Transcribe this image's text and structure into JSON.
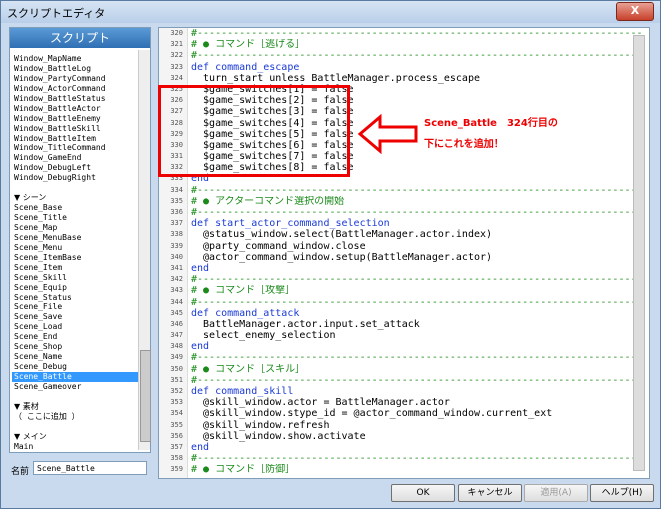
{
  "window": {
    "title": "スクリプトエディタ",
    "close_label": "X"
  },
  "left": {
    "header": "スクリプト",
    "items": [
      {
        "label": "Window_MapName",
        "type": "item"
      },
      {
        "label": "Window_BattleLog",
        "type": "item"
      },
      {
        "label": "Window_PartyCommand",
        "type": "item"
      },
      {
        "label": "Window_ActorCommand",
        "type": "item"
      },
      {
        "label": "Window_BattleStatus",
        "type": "item"
      },
      {
        "label": "Window_BattleActor",
        "type": "item"
      },
      {
        "label": "Window_BattleEnemy",
        "type": "item"
      },
      {
        "label": "Window_BattleSkill",
        "type": "item"
      },
      {
        "label": "Window_BattleItem",
        "type": "item"
      },
      {
        "label": "Window_TitleCommand",
        "type": "item"
      },
      {
        "label": "Window_GameEnd",
        "type": "item"
      },
      {
        "label": "Window_DebugLeft",
        "type": "item"
      },
      {
        "label": "Window_DebugRight",
        "type": "item"
      },
      {
        "label": "",
        "type": "blank"
      },
      {
        "label": "▼ シーン",
        "type": "section"
      },
      {
        "label": "Scene_Base",
        "type": "item"
      },
      {
        "label": "Scene_Title",
        "type": "item"
      },
      {
        "label": "Scene_Map",
        "type": "item"
      },
      {
        "label": "Scene_MenuBase",
        "type": "item"
      },
      {
        "label": "Scene_Menu",
        "type": "item"
      },
      {
        "label": "Scene_ItemBase",
        "type": "item"
      },
      {
        "label": "Scene_Item",
        "type": "item"
      },
      {
        "label": "Scene_Skill",
        "type": "item"
      },
      {
        "label": "Scene_Equip",
        "type": "item"
      },
      {
        "label": "Scene_Status",
        "type": "item"
      },
      {
        "label": "Scene_File",
        "type": "item"
      },
      {
        "label": "Scene_Save",
        "type": "item"
      },
      {
        "label": "Scene_Load",
        "type": "item"
      },
      {
        "label": "Scene_End",
        "type": "item"
      },
      {
        "label": "Scene_Shop",
        "type": "item"
      },
      {
        "label": "Scene_Name",
        "type": "item"
      },
      {
        "label": "Scene_Debug",
        "type": "item"
      },
      {
        "label": "Scene_Battle",
        "type": "item",
        "selected": true
      },
      {
        "label": "Scene_Gameover",
        "type": "item"
      },
      {
        "label": "",
        "type": "blank"
      },
      {
        "label": "▼ 素材",
        "type": "section"
      },
      {
        "label": "（ ここに追加 ）",
        "type": "item"
      },
      {
        "label": "",
        "type": "blank"
      },
      {
        "label": "▼ メイン",
        "type": "section"
      },
      {
        "label": "Main",
        "type": "item"
      }
    ],
    "name_label": "名前",
    "name_value": "Scene_Battle"
  },
  "editor": {
    "line_numbers": [
      "320",
      "321",
      "322",
      "323",
      "324",
      "325",
      "326",
      "327",
      "328",
      "329",
      "330",
      "331",
      "332",
      "333",
      "334",
      "335",
      "336",
      "337",
      "338",
      "339",
      "340",
      "341",
      "342",
      "343",
      "344",
      "345",
      "346",
      "347",
      "348",
      "349",
      "350",
      "351",
      "352",
      "353",
      "354",
      "355",
      "356",
      "357",
      "358",
      "359"
    ],
    "lines": [
      {
        "text": "#--------------------------------------------------------------------------",
        "cls": "cm"
      },
      {
        "text": "# ● コマンド［逃げる］",
        "cls": "cm"
      },
      {
        "text": "#--------------------------------------------------------------------------",
        "cls": "cm"
      },
      {
        "text": "def command_escape",
        "cls": "kw"
      },
      {
        "text": "  turn_start unless BattleManager.process_escape",
        "cls": ""
      },
      {
        "text": "  $game_switches[1] = false",
        "cls": ""
      },
      {
        "text": "  $game_switches[2] = false",
        "cls": ""
      },
      {
        "text": "  $game_switches[3] = false",
        "cls": ""
      },
      {
        "text": "  $game_switches[4] = false",
        "cls": ""
      },
      {
        "text": "  $game_switches[5] = false",
        "cls": ""
      },
      {
        "text": "  $game_switches[6] = false",
        "cls": ""
      },
      {
        "text": "  $game_switches[7] = false",
        "cls": ""
      },
      {
        "text": "  $game_switches[8] = false",
        "cls": ""
      },
      {
        "text": "end",
        "cls": "kw"
      },
      {
        "text": "#--------------------------------------------------------------------------",
        "cls": "cm"
      },
      {
        "text": "# ● アクターコマンド選択の開始",
        "cls": "cm"
      },
      {
        "text": "#--------------------------------------------------------------------------",
        "cls": "cm"
      },
      {
        "text": "def start_actor_command_selection",
        "cls": "kw"
      },
      {
        "text": "  @status_window.select(BattleManager.actor.index)",
        "cls": ""
      },
      {
        "text": "  @party_command_window.close",
        "cls": ""
      },
      {
        "text": "  @actor_command_window.setup(BattleManager.actor)",
        "cls": ""
      },
      {
        "text": "end",
        "cls": "kw"
      },
      {
        "text": "#--------------------------------------------------------------------------",
        "cls": "cm"
      },
      {
        "text": "# ● コマンド［攻撃］",
        "cls": "cm"
      },
      {
        "text": "#--------------------------------------------------------------------------",
        "cls": "cm"
      },
      {
        "text": "def command_attack",
        "cls": "kw"
      },
      {
        "text": "  BattleManager.actor.input.set_attack",
        "cls": ""
      },
      {
        "text": "  select_enemy_selection",
        "cls": ""
      },
      {
        "text": "end",
        "cls": "kw"
      },
      {
        "text": "#--------------------------------------------------------------------------",
        "cls": "cm"
      },
      {
        "text": "# ● コマンド［スキル］",
        "cls": "cm"
      },
      {
        "text": "#--------------------------------------------------------------------------",
        "cls": "cm"
      },
      {
        "text": "def command_skill",
        "cls": "kw"
      },
      {
        "text": "  @skill_window.actor = BattleManager.actor",
        "cls": ""
      },
      {
        "text": "  @skill_window.stype_id = @actor_command_window.current_ext",
        "cls": ""
      },
      {
        "text": "  @skill_window.refresh",
        "cls": ""
      },
      {
        "text": "  @skill_window.show.activate",
        "cls": ""
      },
      {
        "text": "end",
        "cls": "kw"
      },
      {
        "text": "#--------------------------------------------------------------------------",
        "cls": "cm"
      },
      {
        "text": "# ● コマンド［防御］",
        "cls": "cm"
      }
    ]
  },
  "annotation": {
    "line1": "Scene_Battle　324行目の",
    "line2": "下にこれを追加！"
  },
  "buttons": {
    "ok": "OK",
    "cancel": "キャンセル",
    "apply": "適用(A)",
    "help": "ヘルプ(H)"
  }
}
